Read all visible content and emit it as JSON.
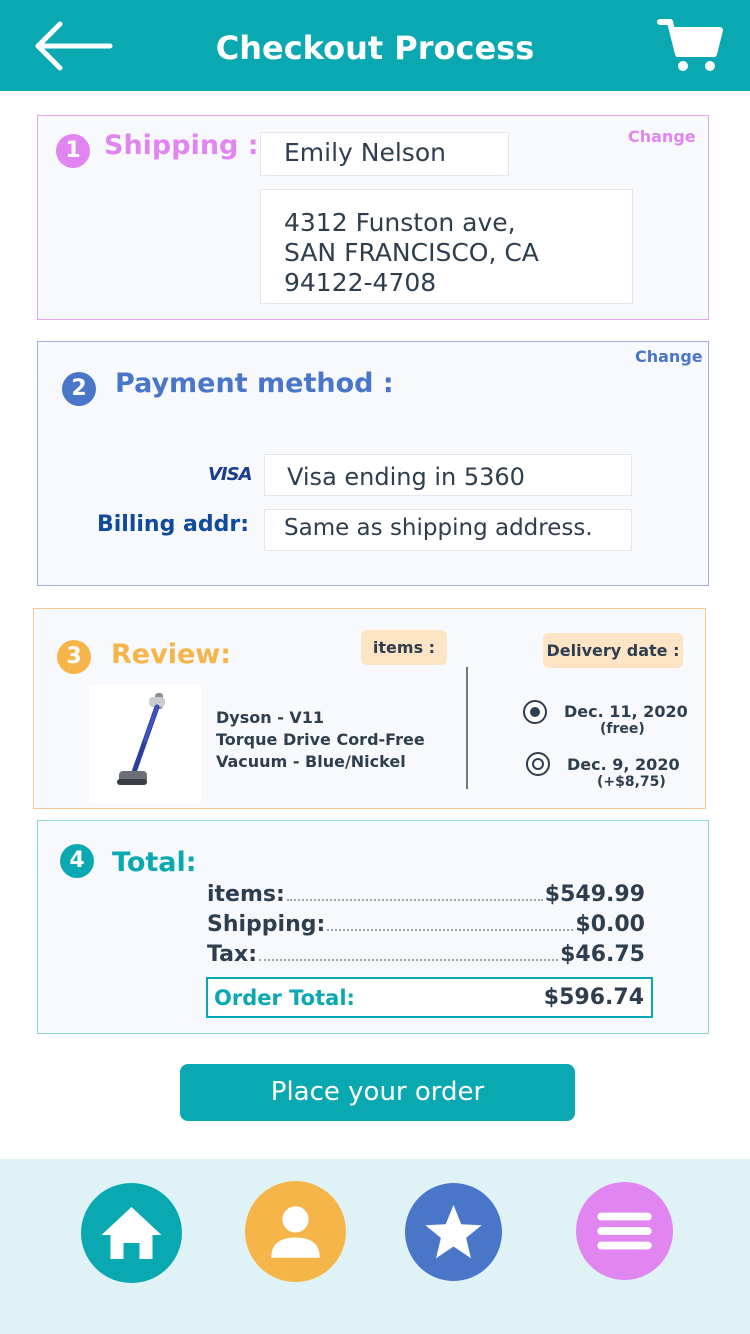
{
  "header": {
    "title": "Checkout Process",
    "colors": {
      "bar": "#0aa9b1",
      "text": "#ffffff"
    }
  },
  "shipping": {
    "step": "1",
    "title": "Shipping :",
    "change_label": "Change",
    "name": "Emily Nelson",
    "address_lines": [
      "4312 Funston ave,",
      "SAN FRANCISCO, CA",
      "94122-4708"
    ],
    "color": "#e186f0"
  },
  "payment": {
    "step": "2",
    "title": "Payment method :",
    "change_label": "Change",
    "card_brand": "VISA",
    "card_text": "Visa ending in 5360",
    "billing_label": "Billing addr:",
    "billing_value": "Same as shipping address.",
    "color": "#4a76c9"
  },
  "review": {
    "step": "3",
    "title": "Review:",
    "items_label": "items :",
    "delivery_label": "Delivery date :",
    "product": {
      "name_lines": [
        "Dyson - V11",
        "Torque Drive Cord-Free",
        "Vacuum - Blue/Nickel"
      ],
      "image": "stick-vacuum-image"
    },
    "delivery_options": [
      {
        "date": "Dec. 11, 2020",
        "note": "(free)",
        "selected": true
      },
      {
        "date": "Dec. 9, 2020",
        "note": "(+$8,75)",
        "selected": false
      }
    ],
    "color": "#f6b549"
  },
  "total": {
    "step": "4",
    "title": "Total:",
    "lines": [
      {
        "label": "items:",
        "value": "$549.99"
      },
      {
        "label": "Shipping:",
        "value": "$0.00"
      },
      {
        "label": "Tax:",
        "value": "$46.75"
      }
    ],
    "order_total_label": "Order Total:",
    "order_total_value": "$596.74",
    "color": "#0aa9b1"
  },
  "actions": {
    "place_order_label": "Place your order"
  },
  "bottom_nav": {
    "items": [
      {
        "icon": "home-icon",
        "color": "#0aa9b1"
      },
      {
        "icon": "profile-icon",
        "color": "#f6b549"
      },
      {
        "icon": "star-icon",
        "color": "#4a76c9"
      },
      {
        "icon": "menu-icon",
        "color": "#e186f0"
      }
    ],
    "background": "#dff2f6"
  }
}
